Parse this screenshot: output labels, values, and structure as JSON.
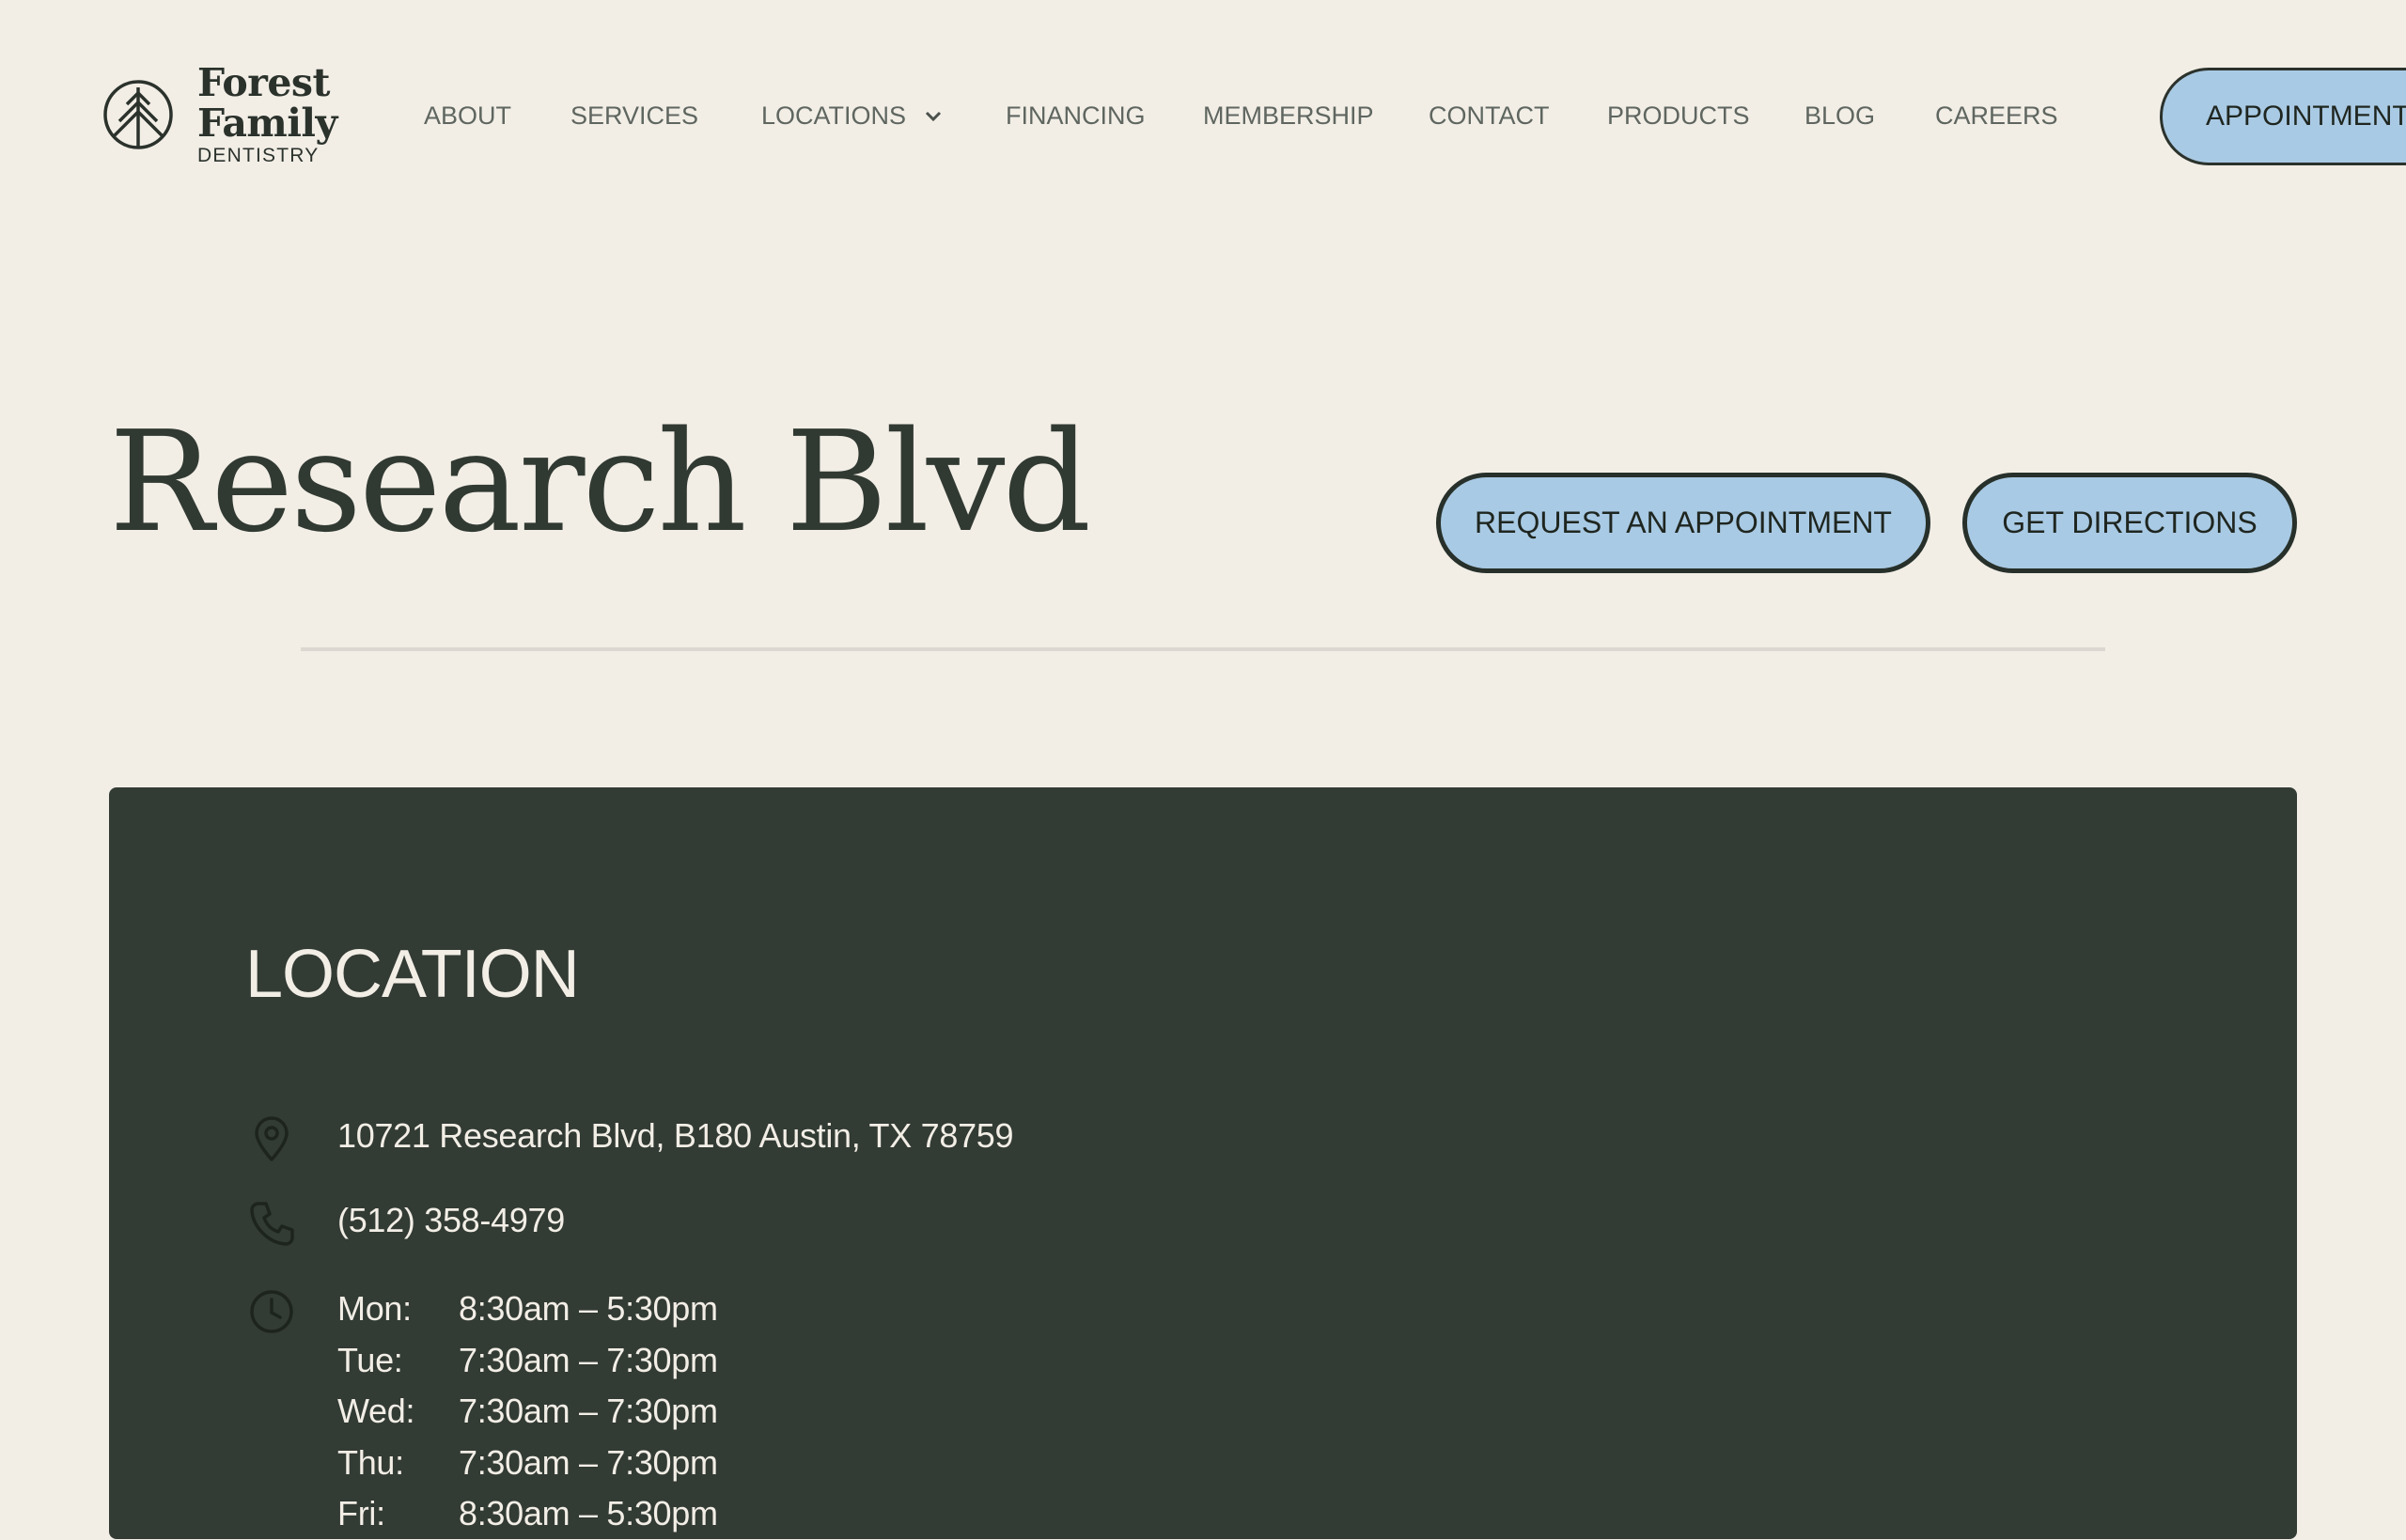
{
  "brand": {
    "line1": "Forest",
    "line2": "Family",
    "line3": "DENTISTRY"
  },
  "nav": {
    "items": [
      {
        "label": "ABOUT"
      },
      {
        "label": "SERVICES"
      },
      {
        "label": "LOCATIONS",
        "has_dropdown": true
      },
      {
        "label": "FINANCING"
      },
      {
        "label": "MEMBERSHIP"
      },
      {
        "label": "CONTACT"
      },
      {
        "label": "PRODUCTS"
      },
      {
        "label": "BLOG"
      },
      {
        "label": "CAREERS"
      }
    ],
    "cta_label": "APPOINTMENT"
  },
  "hero": {
    "title": "Research Blvd",
    "request_label": "REQUEST AN APPOINTMENT",
    "directions_label": "GET DIRECTIONS"
  },
  "location": {
    "heading": "LOCATION",
    "address": "10721 Research Blvd, B180 Austin, TX 78759",
    "phone": "(512) 358-4979",
    "hours": [
      {
        "day": "Mon:",
        "time": "8:30am – 5:30pm"
      },
      {
        "day": "Tue:",
        "time": "7:30am – 7:30pm"
      },
      {
        "day": "Wed:",
        "time": "7:30am – 7:30pm"
      },
      {
        "day": "Thu:",
        "time": "7:30am – 7:30pm"
      },
      {
        "day": "Fri:",
        "time": "8:30am – 5:30pm"
      }
    ]
  },
  "colors": {
    "background": "#f2eee6",
    "text_dark": "#313a32",
    "card_bg": "#323b34",
    "button_fill": "#a9cae4",
    "nav_text": "#5f6660"
  }
}
